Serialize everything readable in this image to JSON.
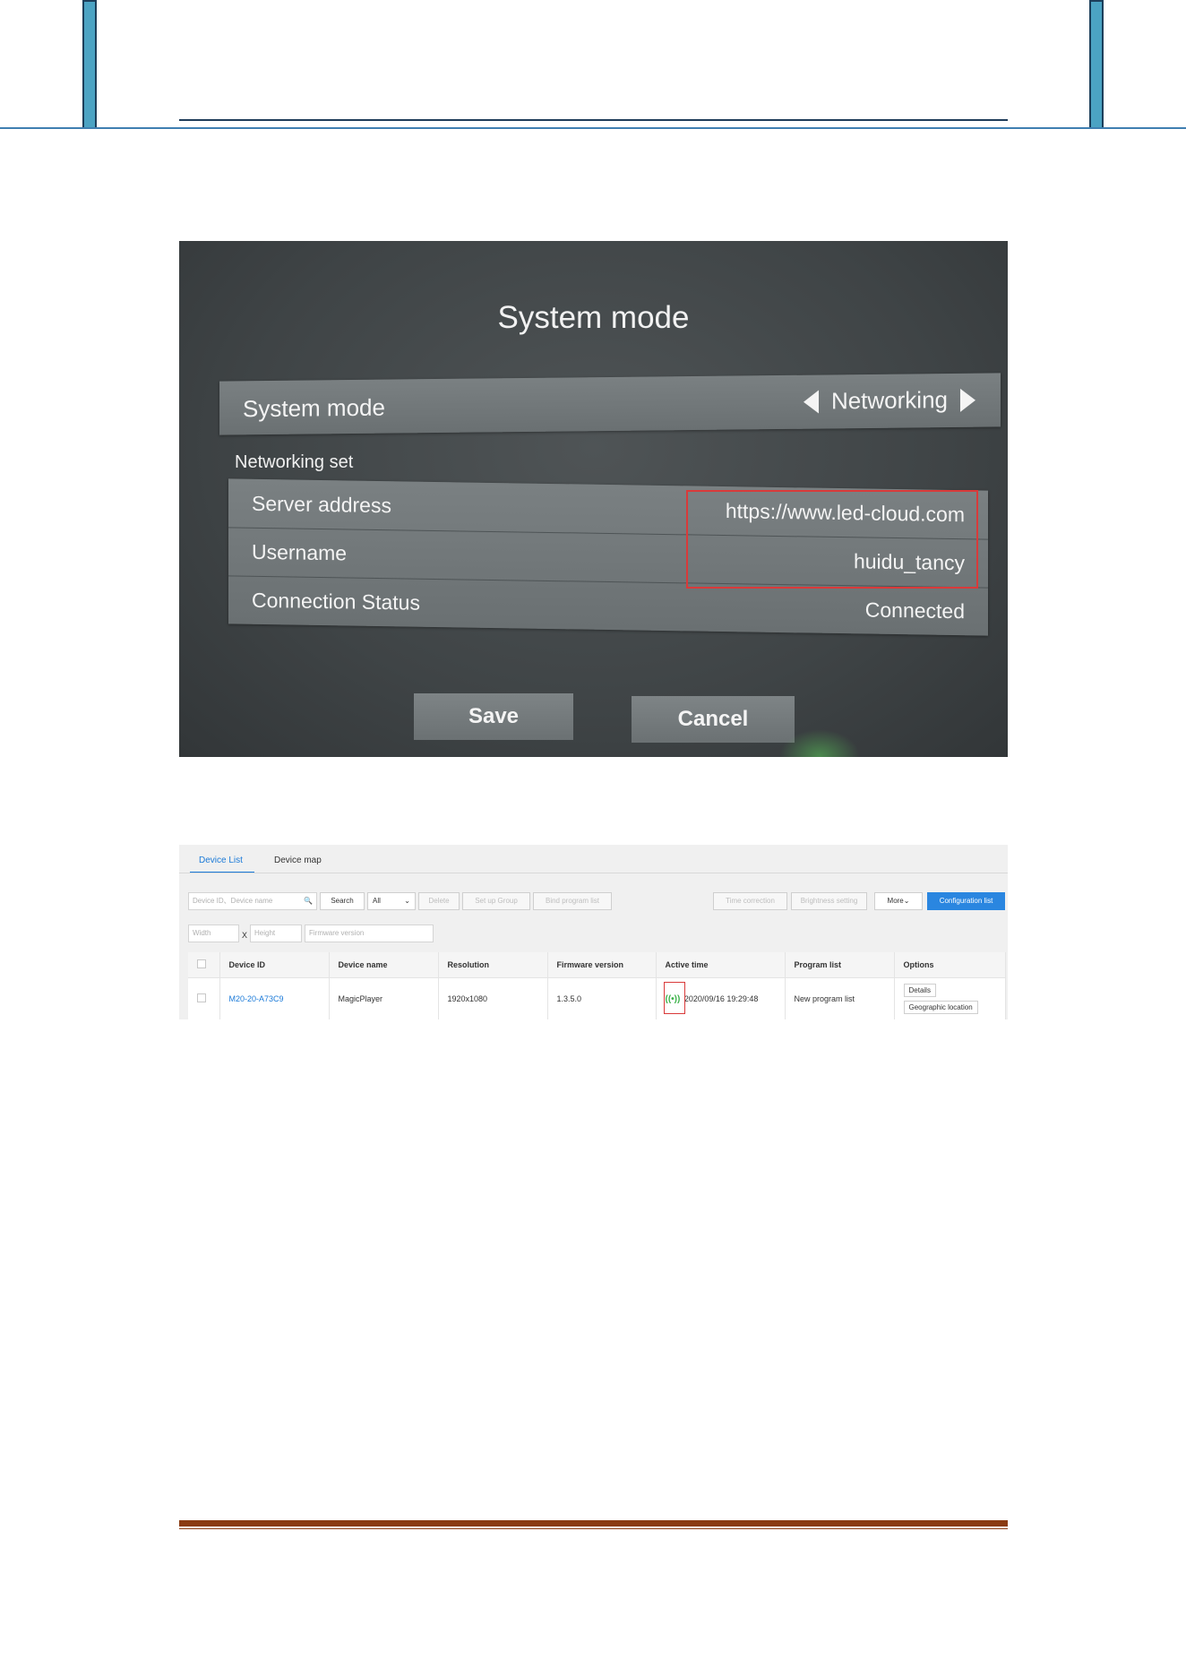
{
  "photo": {
    "title": "System mode",
    "mode_label": "System mode",
    "mode_value": "Networking",
    "section_label": "Networking set",
    "rows": [
      {
        "key": "Server address",
        "value": "https://www.led-cloud.com"
      },
      {
        "key": "Username",
        "value": "huidu_tancy"
      },
      {
        "key": "Connection Status",
        "value": "Connected"
      }
    ],
    "save_label": "Save",
    "cancel_label": "Cancel"
  },
  "web": {
    "tabs": [
      "Device List",
      "Device map"
    ],
    "search_placeholder": "Device ID、Device name",
    "search_label": "Search",
    "filter_value": "All",
    "delete_label": "Delete",
    "setup_group_label": "Set up Group",
    "bind_program_label": "Bind program list",
    "time_correction_label": "Time correction",
    "brightness_label": "Brightness setting",
    "more_label": "More",
    "config_label": "Configuration list",
    "width_placeholder": "Width",
    "x_sep": "X",
    "height_placeholder": "Height",
    "firmware_placeholder": "Firmware version",
    "columns": [
      "Device ID",
      "Device name",
      "Resolution",
      "Firmware version",
      "Active time",
      "Program list",
      "Options"
    ],
    "row": {
      "device_id": "M20-20-A73C9",
      "device_name": "MagicPlayer",
      "resolution": "1920x1080",
      "firmware": "1.3.5.0",
      "active_time": "2020/09/16 19:29:48",
      "program_list": "New program list",
      "details_label": "Details",
      "geo_label": "Geographic location"
    }
  },
  "colors": {
    "header_accent": "#4ba3c3",
    "footer_rule": "#8a3b12",
    "highlight": "#d93a3a",
    "primary_button": "#2a86e0"
  }
}
